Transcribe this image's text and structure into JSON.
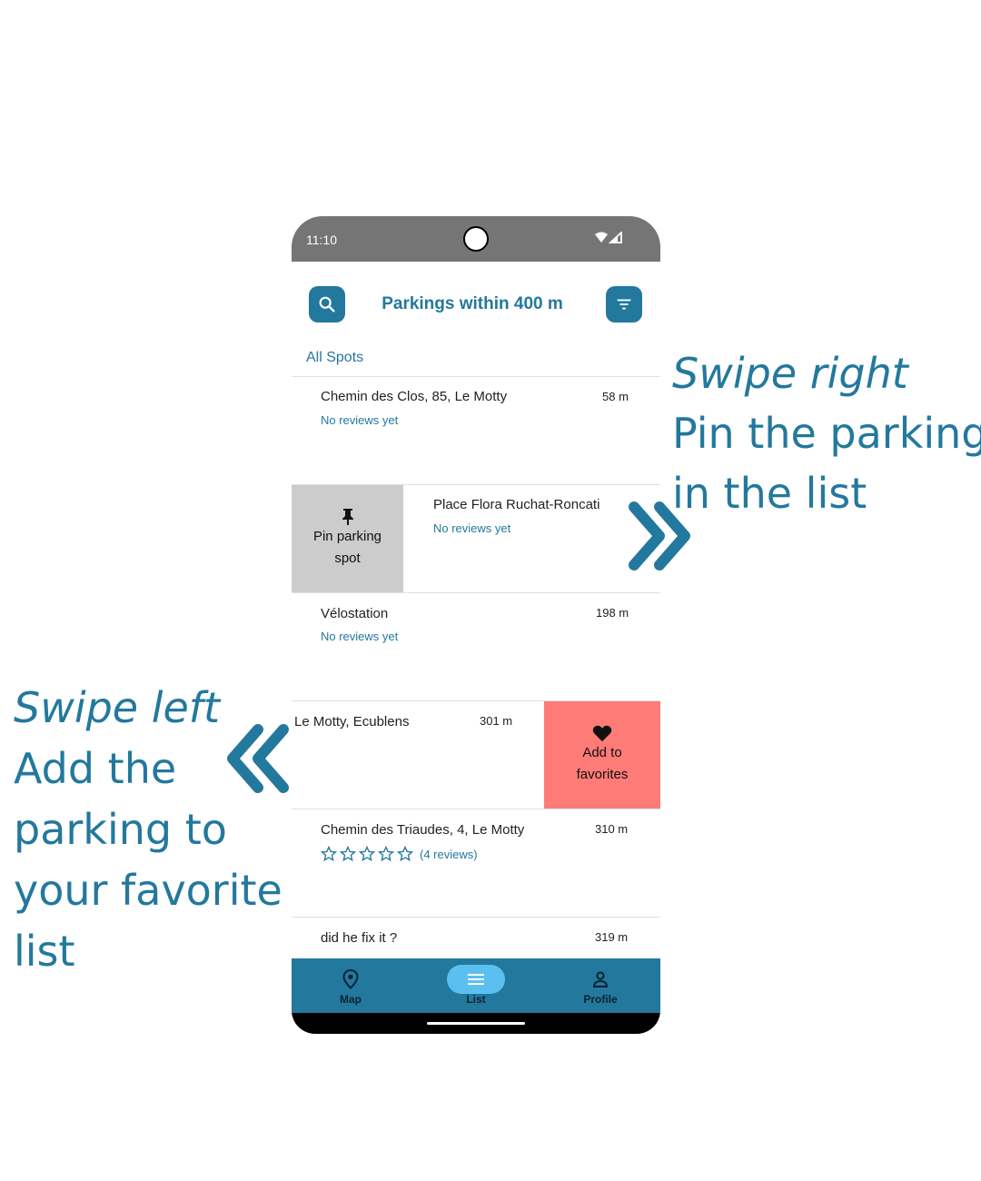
{
  "annotations": {
    "right": {
      "line1": "Swipe right",
      "line2": "Pin the parking",
      "line3": "in the list"
    },
    "left": {
      "line1": "Swipe left",
      "line2": "Add the",
      "line3": "parking to",
      "line4": "your favorite",
      "line5": "list"
    }
  },
  "status_bar": {
    "time": "11:10",
    "icons": [
      "wifi-icon",
      "signal-icon"
    ]
  },
  "header": {
    "title": "Parkings within 400 m",
    "search_icon": "search-icon",
    "filter_icon": "filter-icon"
  },
  "section": {
    "label": "All Spots"
  },
  "list": {
    "items": [
      {
        "name": "Chemin des Clos, 85, Le Motty",
        "distance": "58 m",
        "reviews": "No reviews yet"
      },
      {
        "name": "Place Flora Ruchat-Roncati",
        "distance": "",
        "reviews": "No reviews yet",
        "swipe_action": {
          "line1": "Pin parking",
          "line2": "spot",
          "icon": "pin-icon"
        }
      },
      {
        "name": "Vélostation",
        "distance": "198 m",
        "reviews": "No reviews yet"
      },
      {
        "name": "Le Motty, Ecublens",
        "distance": "301 m",
        "swipe_action": {
          "line1": "Add to",
          "line2": "favorites",
          "icon": "heart-icon"
        }
      },
      {
        "name": "Chemin des Triaudes, 4, Le Motty",
        "distance": "310 m",
        "rating": 0,
        "rating_max": 5,
        "reviews": "(4 reviews)"
      },
      {
        "name": "did he fix it ?",
        "distance": "319 m"
      }
    ]
  },
  "bottom_nav": {
    "items": [
      {
        "label": "Map",
        "icon": "map-pin-icon",
        "active": false
      },
      {
        "label": "List",
        "icon": "list-icon",
        "active": true
      },
      {
        "label": "Profile",
        "icon": "person-icon",
        "active": false
      }
    ]
  },
  "colors": {
    "accent": "#23789d",
    "favorite": "#ff7b78",
    "pin_action": "#cccccc",
    "status_bar": "#757575",
    "nav_active": "#5bc0f0"
  }
}
